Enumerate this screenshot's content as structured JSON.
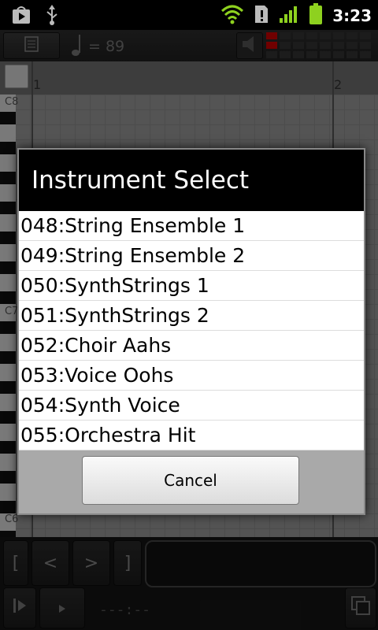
{
  "status_bar": {
    "time": "3:23",
    "icons": [
      "play-store-icon",
      "usb-icon",
      "wifi-icon",
      "alert-icon",
      "signal-icon",
      "battery-icon"
    ]
  },
  "toolbar": {
    "tempo_text": "= 89",
    "icons": [
      "menu-icon",
      "quarter-note-icon",
      "speaker-icon"
    ]
  },
  "piano_roll": {
    "ruler_numbers": [
      "1",
      "2"
    ],
    "octave_labels": [
      "C8",
      "C7",
      "C6"
    ]
  },
  "dialog": {
    "title": "Instrument Select",
    "items": [
      "048:String Ensemble 1",
      "049:String Ensemble 2",
      "050:SynthStrings 1",
      "051:SynthStrings 2",
      "052:Choir Aahs",
      "053:Voice Oohs",
      "054:Synth Voice",
      "055:Orchestra Hit"
    ],
    "cancel_label": "Cancel"
  },
  "bottom_controls": {
    "loop_start_label": "[",
    "prev_label": "<",
    "next_label": ">",
    "loop_end_label": "]",
    "timecode": "---:--"
  },
  "colors": {
    "status_green": "#8ed11f",
    "meter_red": "#cc0000",
    "dialog_title_bg": "#000000",
    "list_bg": "#ffffff",
    "footer_bg": "#a9a9a9"
  }
}
